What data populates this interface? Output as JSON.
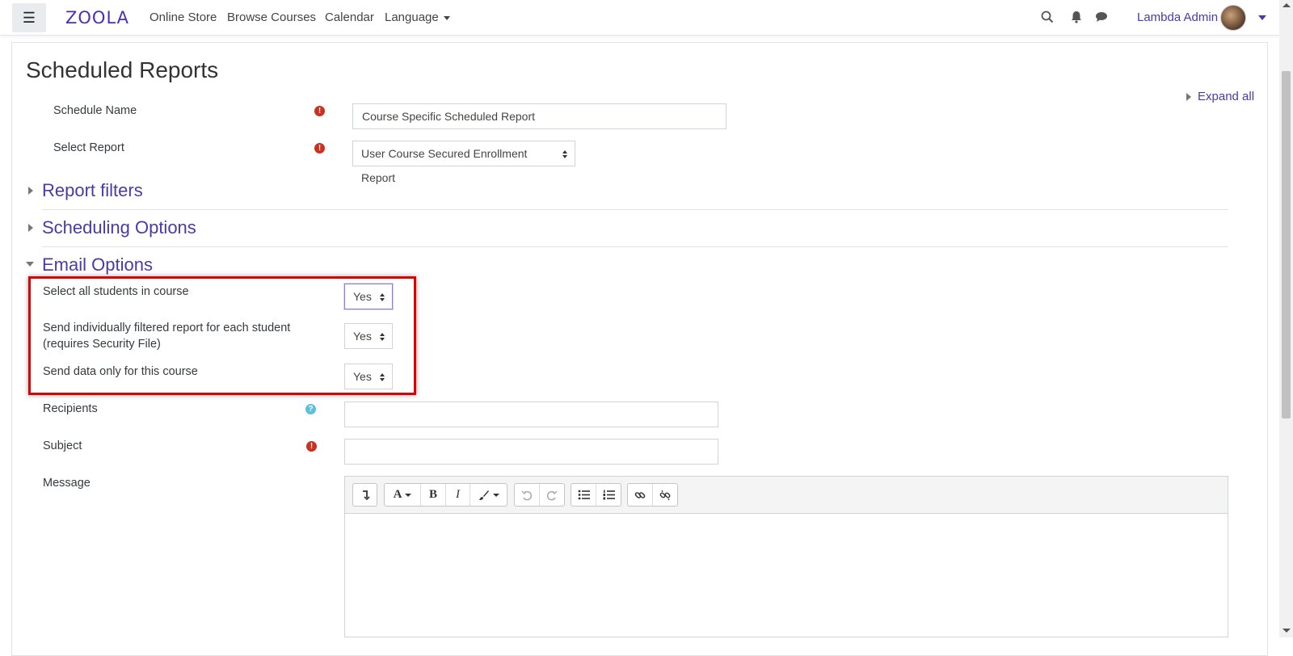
{
  "navbar": {
    "logo": "ZOOLA",
    "links": [
      "Online Store",
      "Browse Courses",
      "Calendar",
      "Language"
    ],
    "username": "Lambda Admin"
  },
  "page": {
    "title": "Scheduled Reports",
    "expand_all": "Expand all"
  },
  "form": {
    "schedule_name_label": "Schedule Name",
    "schedule_name_value": "Course Specific Scheduled Report",
    "select_report_label": "Select Report",
    "select_report_value": "User Course Secured Enrollment Report"
  },
  "sections": {
    "report_filters": "Report filters",
    "scheduling_options": "Scheduling Options",
    "email_options": "Email Options"
  },
  "email_options": {
    "select_all_label": "Select all students in course",
    "select_all_value": "Yes",
    "send_individual_label_line1": "Send individually filtered report for each student",
    "send_individual_label_line2": "(requires Security File)",
    "send_individual_value": "Yes",
    "send_data_only_label": "Send data only for this course",
    "send_data_only_value": "Yes",
    "recipients_label": "Recipients",
    "recipients_value": "",
    "subject_label": "Subject",
    "subject_value": "",
    "message_label": "Message"
  },
  "editor_toolbar": {
    "font_label": "A",
    "bold_label": "B",
    "italic_label": "I"
  },
  "colors": {
    "accent": "#4a3aa8",
    "required": "#ca3120",
    "help": "#5bc0de",
    "highlight": "#e00000"
  }
}
